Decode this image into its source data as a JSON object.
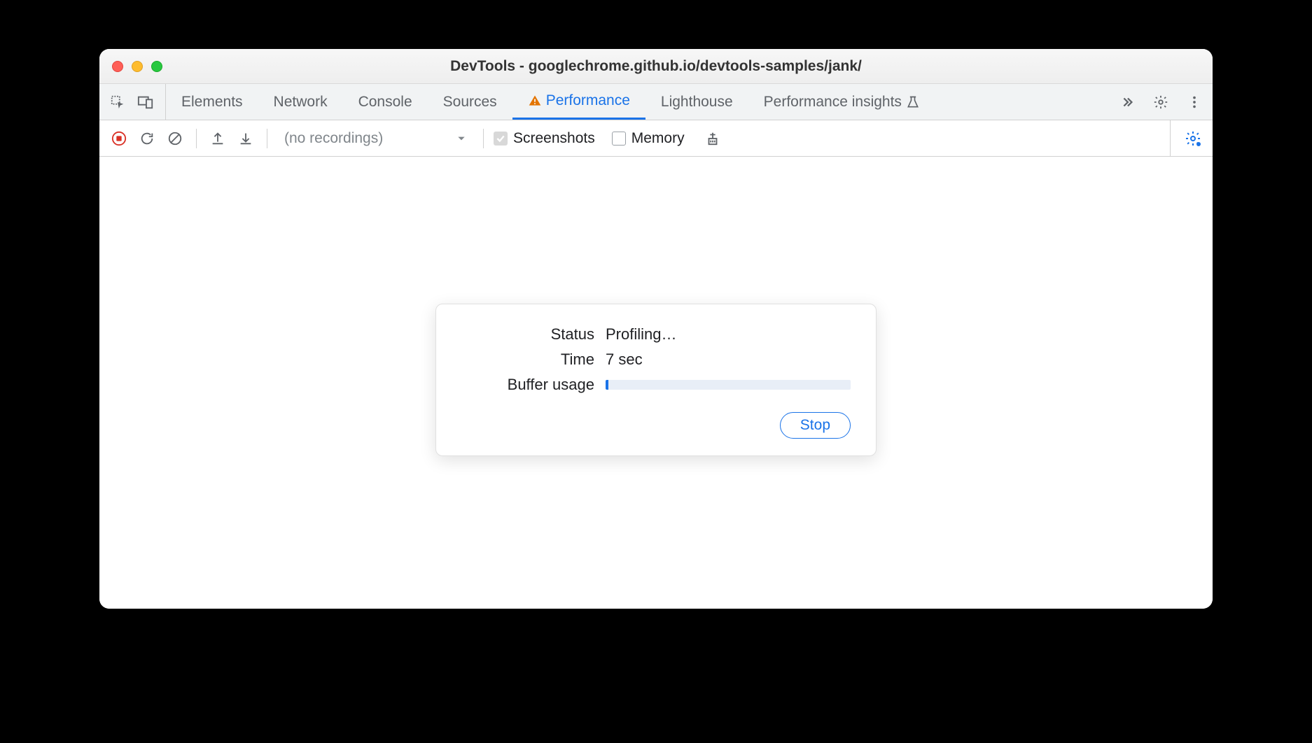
{
  "window": {
    "title": "DevTools - googlechrome.github.io/devtools-samples/jank/"
  },
  "tabs": {
    "elements": "Elements",
    "network": "Network",
    "console": "Console",
    "sources": "Sources",
    "performance": "Performance",
    "lighthouse": "Lighthouse",
    "performance_insights": "Performance insights"
  },
  "toolbar": {
    "recordings_placeholder": "(no recordings)",
    "screenshots_label": "Screenshots",
    "memory_label": "Memory"
  },
  "dialog": {
    "status_label": "Status",
    "status_value": "Profiling…",
    "time_label": "Time",
    "time_value": "7 sec",
    "buffer_label": "Buffer usage",
    "buffer_percent": 1,
    "stop_label": "Stop"
  }
}
